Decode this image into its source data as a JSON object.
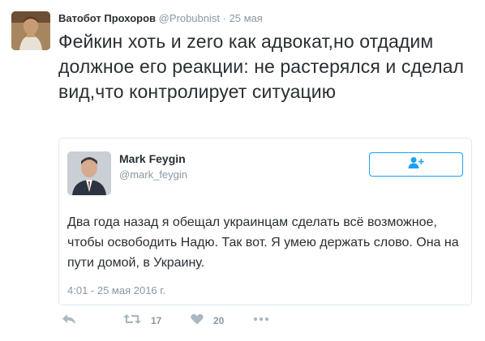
{
  "tweet": {
    "author_name": "Ватобот Прохоров",
    "author_handle": "@Probubnist",
    "separator": " · ",
    "time": "25 мая",
    "text": "Фейкин хоть и zero как адвокат,но отдадим должное его реакции: не растерялся и сделал вид,что контролирует ситуацию"
  },
  "quoted": {
    "author_name": "Mark Feygin",
    "author_handle": "@mark_feygin",
    "text": "Два года назад я обещал украинцам сделать всё возможное, чтобы освободить Надю. Так вот. Я умею держать слово. Она на пути домой, в Украину.",
    "timestamp": "4:01 - 25 мая 2016 г.",
    "follow_icon": "add-user-icon"
  },
  "actions": {
    "reply_icon": "reply-icon",
    "retweet_icon": "retweet-icon",
    "retweet_count": "17",
    "like_icon": "heart-icon",
    "like_count": "20",
    "more_icon": "more-icon"
  },
  "colors": {
    "accent": "#1da1f2",
    "muted": "#8899a6",
    "text": "#292f33",
    "border": "#e1e8ed"
  }
}
